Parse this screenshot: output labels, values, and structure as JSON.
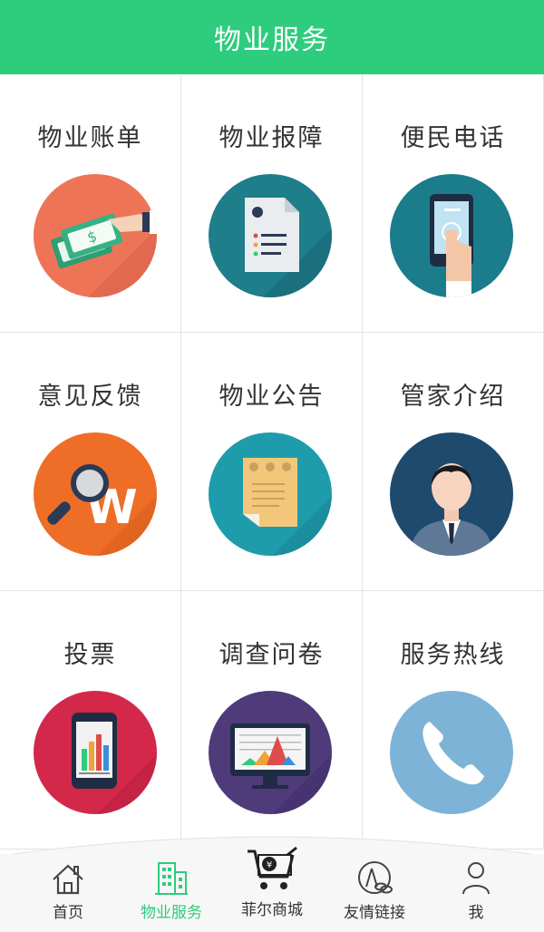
{
  "header": {
    "title": "物业服务"
  },
  "grid": {
    "items": [
      {
        "label": "物业账单",
        "icon": "money-hand-icon",
        "color": "#ee7458"
      },
      {
        "label": "物业报障",
        "icon": "document-icon",
        "color": "#1e7e8a"
      },
      {
        "label": "便民电话",
        "icon": "phone-touch-icon",
        "color": "#1b7c8b"
      },
      {
        "label": "意见反馈",
        "icon": "magnifier-w-icon",
        "color": "#ee6e27"
      },
      {
        "label": "物业公告",
        "icon": "notice-paper-icon",
        "color": "#1f9cab"
      },
      {
        "label": "管家介绍",
        "icon": "butler-avatar-icon",
        "color": "#1e4a6e"
      },
      {
        "label": "投票",
        "icon": "phone-chart-icon",
        "color": "#d3284a"
      },
      {
        "label": "调查问卷",
        "icon": "monitor-chart-icon",
        "color": "#4f3a7a"
      },
      {
        "label": "服务热线",
        "icon": "handset-icon",
        "color": "#7db3d6"
      }
    ]
  },
  "tabbar": {
    "tabs": [
      {
        "label": "首页",
        "icon": "home-icon"
      },
      {
        "label": "物业服务",
        "icon": "building-icon",
        "active": true
      },
      {
        "label": "菲尔商城",
        "icon": "shopping-cart-icon"
      },
      {
        "label": "友情链接",
        "icon": "link-icon"
      },
      {
        "label": "我",
        "icon": "user-icon"
      }
    ],
    "accent": "#2ecc7d"
  }
}
